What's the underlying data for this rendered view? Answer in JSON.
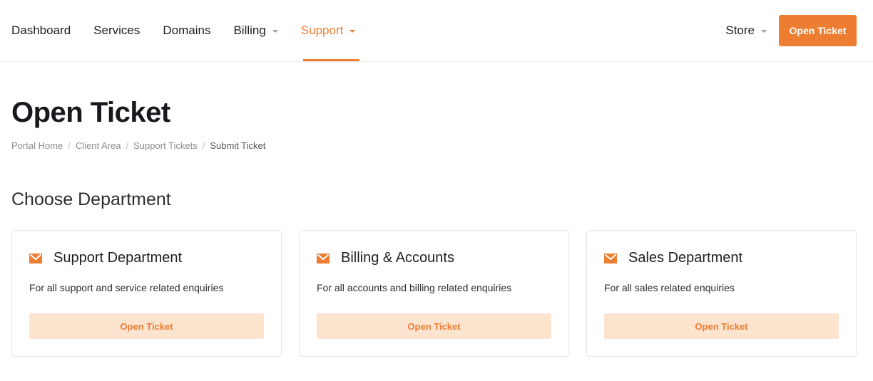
{
  "nav": {
    "items": [
      {
        "label": "Dashboard",
        "dropdown": false
      },
      {
        "label": "Services",
        "dropdown": false
      },
      {
        "label": "Domains",
        "dropdown": false
      },
      {
        "label": "Billing",
        "dropdown": true
      },
      {
        "label": "Support",
        "dropdown": true,
        "active": true
      }
    ],
    "store_label": "Store",
    "open_ticket_label": "Open Ticket"
  },
  "page": {
    "title": "Open Ticket",
    "breadcrumb": [
      "Portal Home",
      "Client Area",
      "Support Tickets",
      "Submit Ticket"
    ],
    "section_title": "Choose Department"
  },
  "departments": [
    {
      "name": "Support Department",
      "description": "For all support and service related enquiries",
      "button": "Open Ticket",
      "icon": "envelope-icon"
    },
    {
      "name": "Billing & Accounts",
      "description": "For all accounts and billing related enquiries",
      "button": "Open Ticket",
      "icon": "envelope-icon"
    },
    {
      "name": "Sales Department",
      "description": "For all sales related enquiries",
      "button": "Open Ticket",
      "icon": "envelope-icon"
    }
  ],
  "colors": {
    "accent": "#ed7d31",
    "accent_light": "#fce4cf",
    "border": "#e6e6e6"
  }
}
